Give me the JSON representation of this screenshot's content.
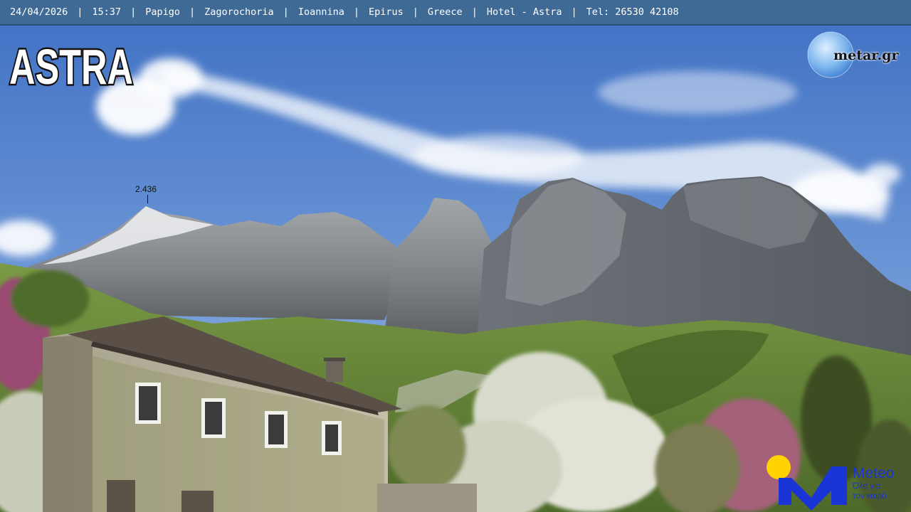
{
  "topbar": {
    "date": "24/04/2026",
    "time": "15:37",
    "village": "Papigo",
    "area": "Zagorochoria",
    "city": "Ioannina",
    "region": "Epirus",
    "country": "Greece",
    "hotel": "Hotel - Astra",
    "phone": "Tel: 26530 42108",
    "separator": "|"
  },
  "overlays": {
    "astra_logo": "ASTRA",
    "metar_logo": "metar.gr",
    "peak_altitude": "2.436",
    "meteo_title": "Meteo",
    "meteo_tagline_1": "Όλα για",
    "meteo_tagline_2": "τον καιρό"
  },
  "colors": {
    "topbar_bg": "#3f6a95",
    "sky_top": "#3f70c4",
    "sky_bottom": "#8fb6e6",
    "rock": "#8e9196",
    "forest": "#6e8e3e",
    "meteo_blue": "#1a34d6",
    "meteo_yellow": "#ffd200",
    "astra_star": "#d8262a"
  }
}
